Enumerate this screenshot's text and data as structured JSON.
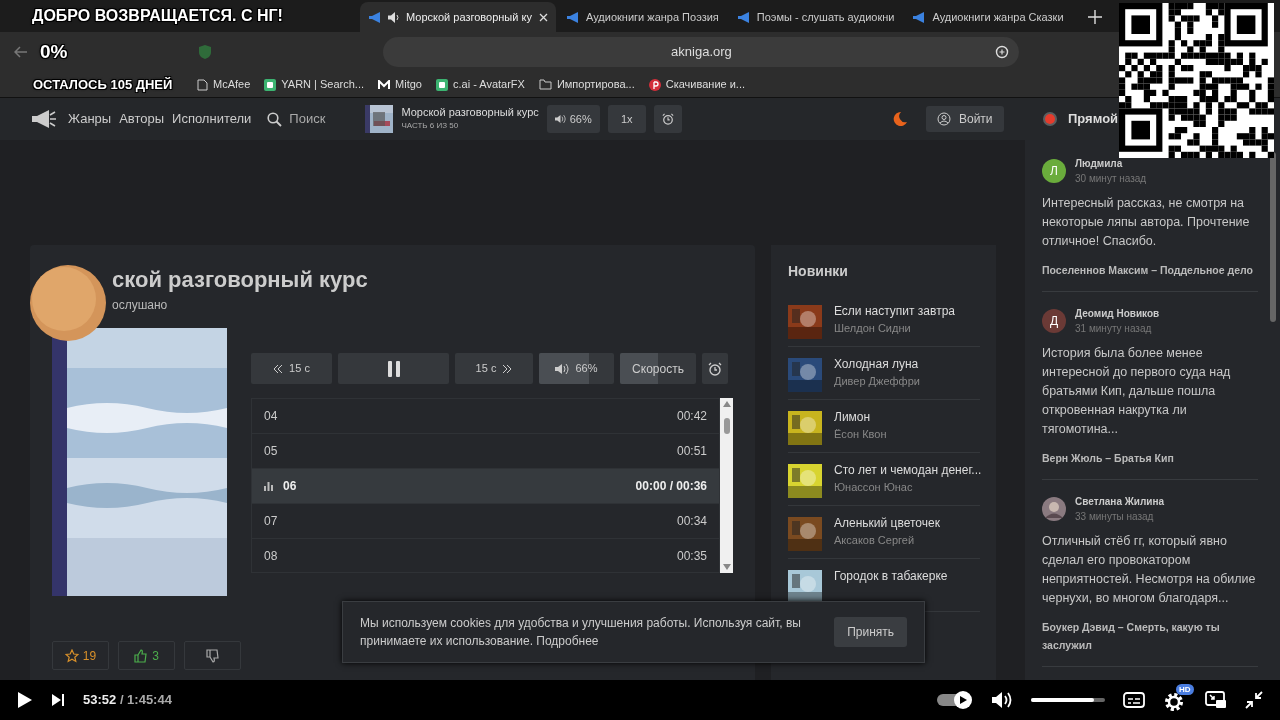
{
  "overlay": {
    "title": "ДОБРО ВОЗВРАЩАЕТСЯ. С НГ!",
    "percent": "0%",
    "countdown": "ОСТАЛОСЬ 105 ДНЕЙ"
  },
  "browser": {
    "tabs": [
      {
        "label": "Морской разговорный ку",
        "selected": true,
        "playing": true
      },
      {
        "label": "Аудиокниги жанра Поэзия",
        "selected": false,
        "playing": false
      },
      {
        "label": "Поэмы - слушать аудиокни",
        "selected": false,
        "playing": false
      },
      {
        "label": "Аудиокниги жанра Сказки",
        "selected": false,
        "playing": false
      }
    ],
    "address": "akniga.org",
    "bookmarks": [
      {
        "label": "McAfee",
        "kind": "page"
      },
      {
        "label": "YARN | Search...",
        "kind": "app"
      },
      {
        "label": "Mitgo",
        "kind": "letter"
      },
      {
        "label": "c.ai - AvatarFX",
        "kind": "app"
      },
      {
        "label": "Импортирова...",
        "kind": "folder"
      },
      {
        "label": "Скачивание и...",
        "kind": "pin"
      }
    ]
  },
  "site": {
    "nav": [
      "Жанры",
      "Авторы",
      "Исполнители"
    ],
    "search": "Поиск",
    "mini_player": {
      "title": "Морской разговорный курс",
      "part": "ЧАСТЬ 6 ИЗ 50",
      "volume": "66%",
      "speed": "1x"
    },
    "login": "Войти",
    "live": "Прямой"
  },
  "book": {
    "title": "ской разговорный курс",
    "listened": "ослушано",
    "controls": {
      "back": "15 с",
      "forward": "15 с",
      "volume": {
        "label": "66%",
        "level": 0.66
      },
      "speed": {
        "label": "Скорость",
        "level": 0.5
      }
    },
    "tracks": [
      {
        "number": "04",
        "time": "00:42",
        "selected": false
      },
      {
        "number": "05",
        "time": "00:51",
        "selected": false
      },
      {
        "number": "06",
        "time": "00:00 / 00:36",
        "selected": true
      },
      {
        "number": "07",
        "time": "00:34",
        "selected": false
      },
      {
        "number": "08",
        "time": "00:35",
        "selected": false
      }
    ],
    "favorites": "19",
    "likes": "3"
  },
  "new_books": {
    "title": "Новинки",
    "items": [
      {
        "title": "Если наступит завтра",
        "author": "Шелдон Сидни",
        "color": "#8a3a1a"
      },
      {
        "title": "Холодная луна",
        "author": "Дивер Джеффри",
        "color": "#2a4a7a"
      },
      {
        "title": "Лимон",
        "author": "Ёсон Квон",
        "color": "#c8b41e"
      },
      {
        "title": "Сто лет и чемодан денег...",
        "author": "Юнассон Юнас",
        "color": "#d8d430"
      },
      {
        "title": "Аленький цветочек",
        "author": "Аксаков Сергей",
        "color": "#7a4a20"
      },
      {
        "title": "Городок в табакерке",
        "color": "#a8c8d8"
      }
    ]
  },
  "cookie": {
    "text": "Мы используем cookies для удобства и улучшения работы. Используя сайт, вы принимаете их использование.",
    "link": "Подробнее",
    "button": "Принять"
  },
  "comments": [
    {
      "author": "Людмила",
      "initial": "Л",
      "color": "#6aac3c",
      "time": "30 минут назад",
      "text": "Интересный рассказ, не смотря на некоторые ляпы автора. Прочтение отличное! Спасибо.",
      "book": "Поселеннов Максим – Поддельное дело"
    },
    {
      "author": "Деомид Новиков",
      "initial": "Д",
      "color": "#6b3a36",
      "time": "31 минуту назад",
      "text": "История была более менее интересной до первого суда над братьями Кип, дальше пошла откровенная накрутка ли тягомотина...",
      "book": "Верн Жюль – Братья Кип"
    },
    {
      "author": "Светлана Жилина",
      "time": "33 минуты назад",
      "text": "Отличный стёб гг, который явно сделал его провокатором неприятностей. Несмотря на обилие чернухи, во многом благодаря...",
      "book": "Боукер Дэвид – Смерть, какую ты заслужил"
    }
  ],
  "video": {
    "time": "53:52",
    "duration": "/ 1:45:44",
    "volume": {
      "level": 0.85
    },
    "autoplay": true,
    "hd": "HD"
  }
}
